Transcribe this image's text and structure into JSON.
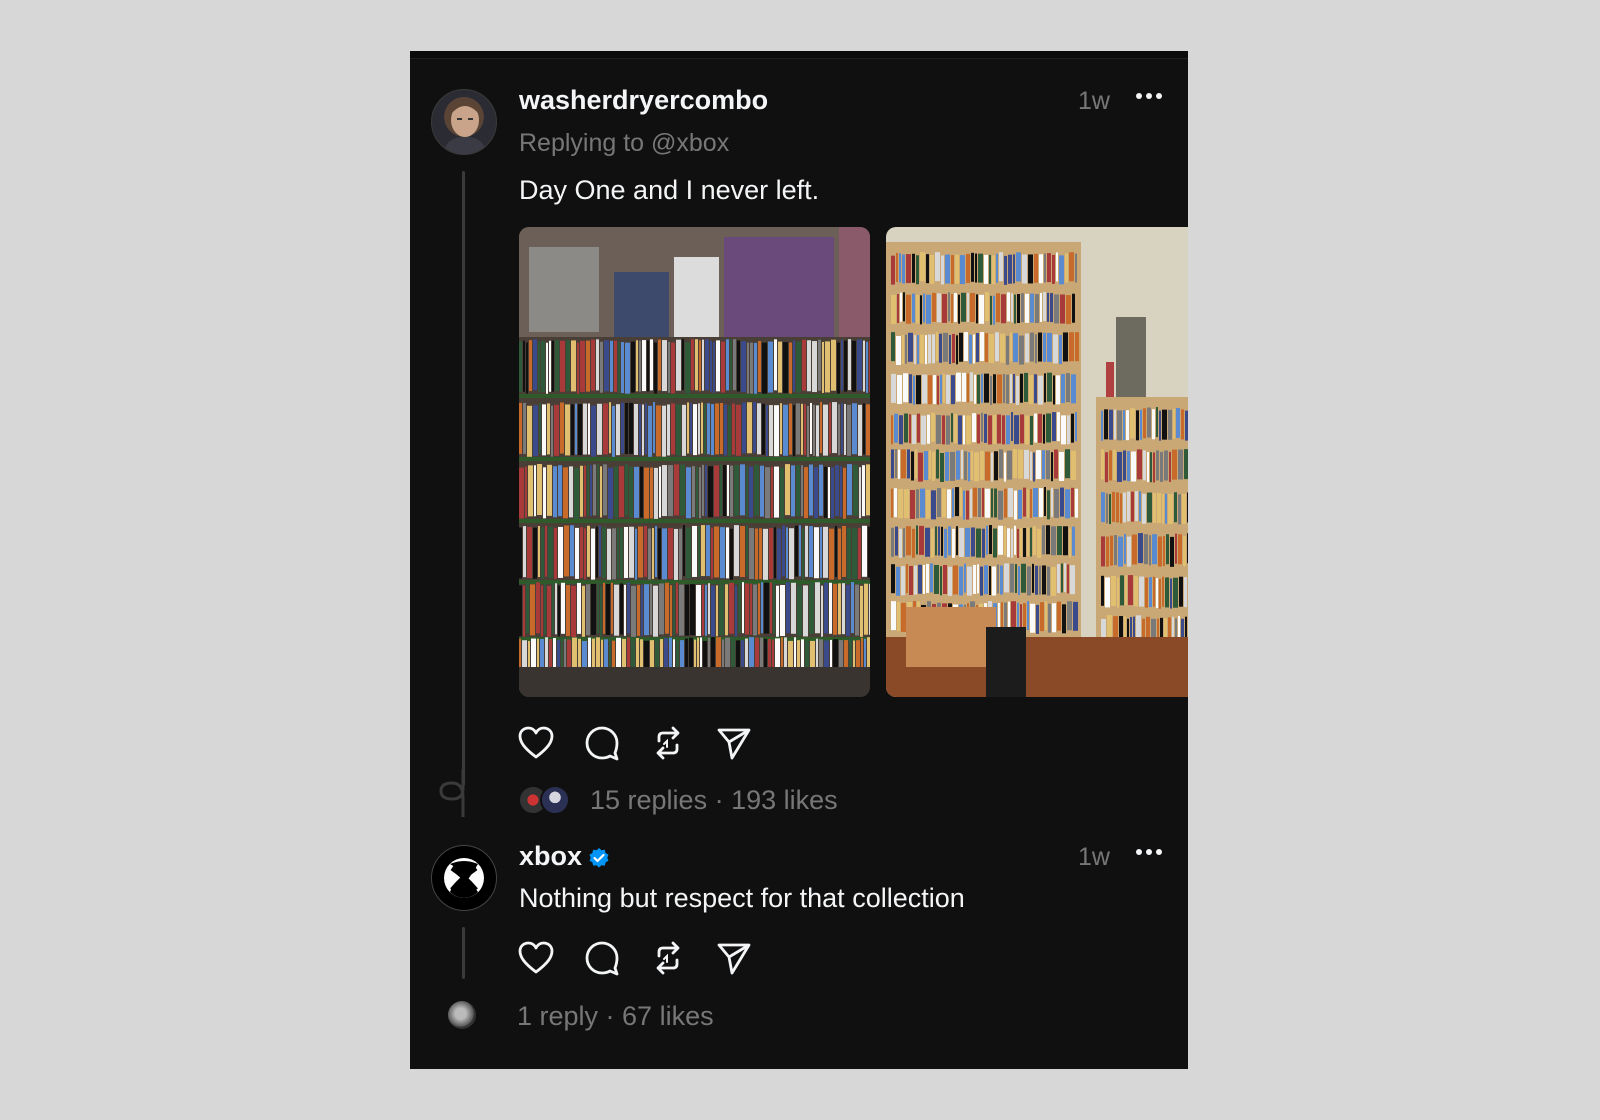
{
  "post": {
    "username": "washerdryercombo",
    "time": "1w",
    "reply_to": "Replying to @xbox",
    "text": "Day One and I never left.",
    "stats": "15 replies · 193 likes"
  },
  "reply": {
    "username": "xbox",
    "time": "1w",
    "text": "Nothing but respect for that collection",
    "stats": "1 reply · 67 likes"
  },
  "icons": [
    "heart-icon",
    "comment-icon",
    "repost-icon",
    "share-icon",
    "more-icon",
    "verified-icon",
    "xbox-logo-icon"
  ],
  "colors": {
    "background": "#101010",
    "text": "#f3f5f7",
    "muted": "#777777",
    "verified": "#0095f6"
  }
}
